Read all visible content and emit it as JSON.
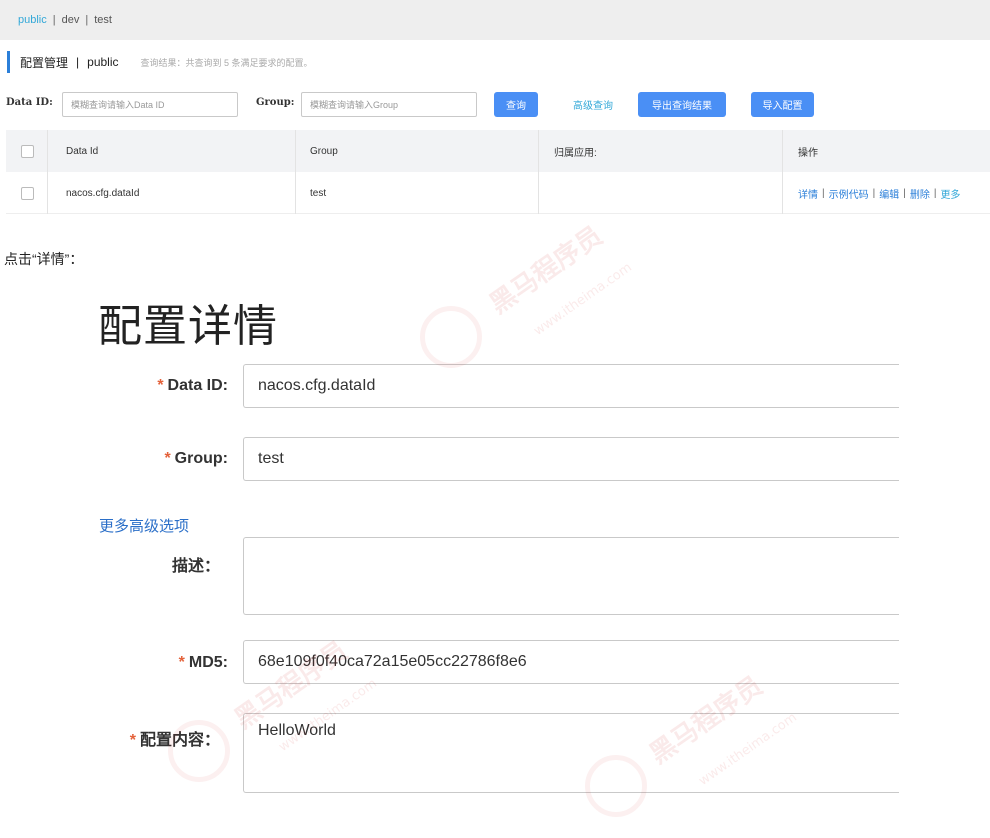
{
  "namespaces": {
    "items": [
      "public",
      "dev",
      "test"
    ],
    "separator": "|",
    "active_index": 0
  },
  "header": {
    "title": "配置管理",
    "separator": "|",
    "namespace": "public",
    "result_text": "查询结果：共查询到 5 条满足要求的配置。"
  },
  "search": {
    "data_id_label": "Data ID:",
    "data_id_placeholder": "模糊查询请输入Data ID",
    "group_label": "Group:",
    "group_placeholder": "模糊查询请输入Group",
    "query_button": "查询",
    "advanced_link": "高级查询",
    "export_button": "导出查询结果",
    "import_button": "导入配置"
  },
  "table": {
    "headers": [
      "Data Id",
      "Group",
      "归属应用:",
      "操作"
    ],
    "rows": [
      {
        "data_id": "nacos.cfg.dataId",
        "group": "test",
        "app": ""
      }
    ],
    "actions": {
      "detail": "详情",
      "sample": "示例代码",
      "edit": "编辑",
      "delete": "删除",
      "more": "更多",
      "separator": "|"
    }
  },
  "instruction": "点击“详情”：",
  "detail": {
    "title": "配置详情",
    "required_mark": "*",
    "fields": {
      "data_id_label": "Data ID:",
      "data_id_value": "nacos.cfg.dataId",
      "group_label": "Group:",
      "group_value": "test",
      "more_options": "更多高级选项",
      "desc_label": "描述：",
      "desc_value": "",
      "md5_label": "MD5:",
      "md5_value": "68e109f0f40ca72a15e05cc22786f8e6",
      "content_label": "配置内容：",
      "content_value": "HelloWorld"
    }
  },
  "watermark": {
    "brand": "黑马程序员",
    "url": "www.itheima.com"
  },
  "colors": {
    "accent": "#2b7fd9",
    "button": "#4a8ff5",
    "link": "#33a8d8",
    "required": "#e4623b"
  }
}
